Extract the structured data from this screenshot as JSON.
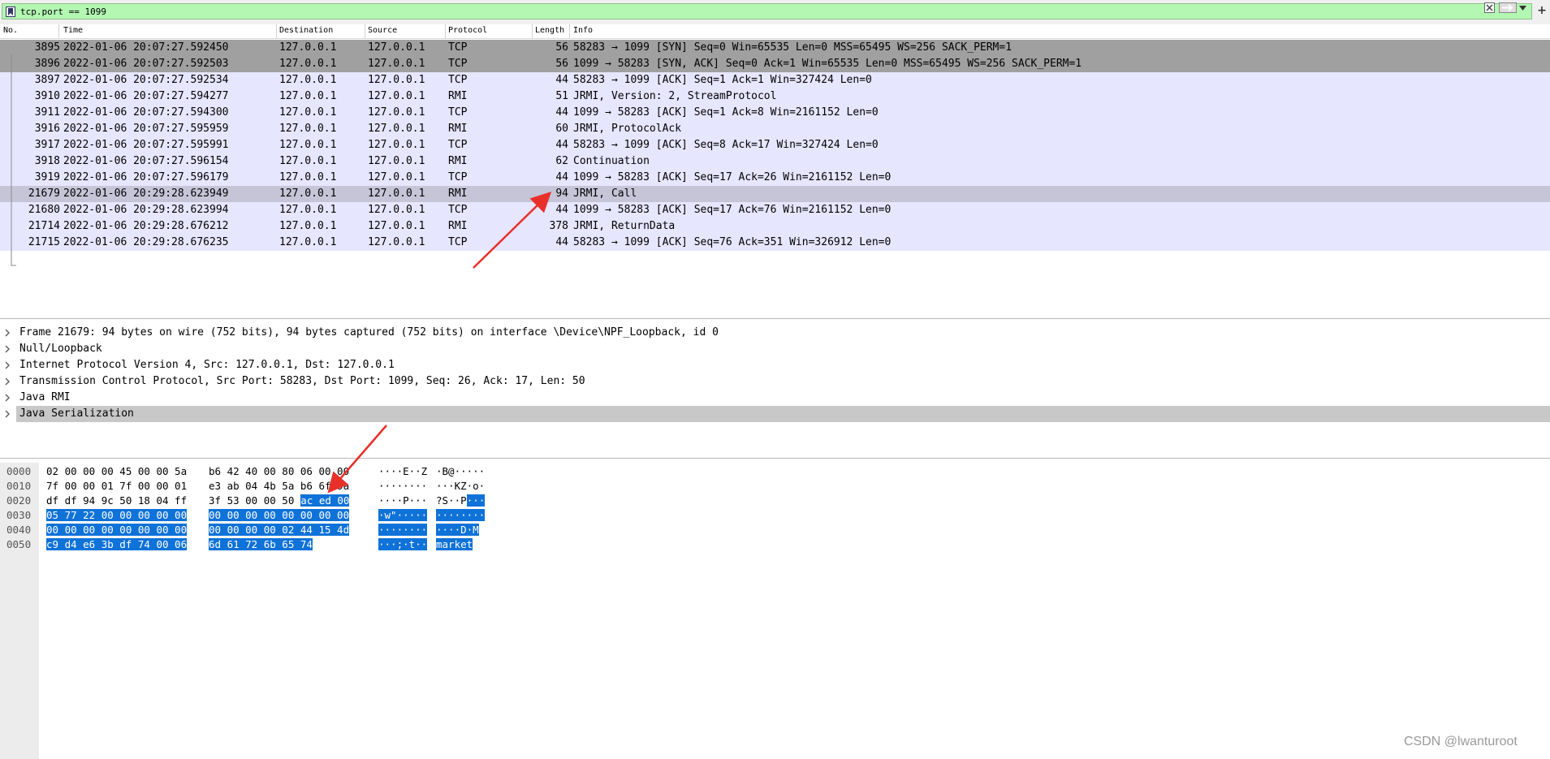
{
  "filter": {
    "value": "tcp.port == 1099",
    "placeholder": "",
    "color": "#b3f7b3"
  },
  "packet_list": {
    "columns": [
      "No.",
      "Time",
      "Destination",
      "Source",
      "Protocol",
      "Length",
      "Info"
    ],
    "rows": [
      {
        "no": "3895",
        "time": "2022-01-06 20:07:27.592450",
        "dst": "127.0.0.1",
        "src": "127.0.0.1",
        "proto": "TCP",
        "len": "56",
        "info": "58283 → 1099 [SYN] Seq=0 Win=65535 Len=0 MSS=65495 WS=256 SACK_PERM=1",
        "bg": "#a0a0a0"
      },
      {
        "no": "3896",
        "time": "2022-01-06 20:07:27.592503",
        "dst": "127.0.0.1",
        "src": "127.0.0.1",
        "proto": "TCP",
        "len": "56",
        "info": "1099 → 58283 [SYN, ACK] Seq=0 Ack=1 Win=65535 Len=0 MSS=65495 WS=256 SACK_PERM=1",
        "bg": "#a0a0a0"
      },
      {
        "no": "3897",
        "time": "2022-01-06 20:07:27.592534",
        "dst": "127.0.0.1",
        "src": "127.0.0.1",
        "proto": "TCP",
        "len": "44",
        "info": "58283 → 1099 [ACK] Seq=1 Ack=1 Win=327424 Len=0",
        "bg": "#e7e6ff"
      },
      {
        "no": "3910",
        "time": "2022-01-06 20:07:27.594277",
        "dst": "127.0.0.1",
        "src": "127.0.0.1",
        "proto": "RMI",
        "len": "51",
        "info": "JRMI, Version: 2, StreamProtocol",
        "bg": "#e7e6ff"
      },
      {
        "no": "3911",
        "time": "2022-01-06 20:07:27.594300",
        "dst": "127.0.0.1",
        "src": "127.0.0.1",
        "proto": "TCP",
        "len": "44",
        "info": "1099 → 58283 [ACK] Seq=1 Ack=8 Win=2161152 Len=0",
        "bg": "#e7e6ff"
      },
      {
        "no": "3916",
        "time": "2022-01-06 20:07:27.595959",
        "dst": "127.0.0.1",
        "src": "127.0.0.1",
        "proto": "RMI",
        "len": "60",
        "info": "JRMI, ProtocolAck",
        "bg": "#e7e6ff"
      },
      {
        "no": "3917",
        "time": "2022-01-06 20:07:27.595991",
        "dst": "127.0.0.1",
        "src": "127.0.0.1",
        "proto": "TCP",
        "len": "44",
        "info": "58283 → 1099 [ACK] Seq=8 Ack=17 Win=327424 Len=0",
        "bg": "#e7e6ff"
      },
      {
        "no": "3918",
        "time": "2022-01-06 20:07:27.596154",
        "dst": "127.0.0.1",
        "src": "127.0.0.1",
        "proto": "RMI",
        "len": "62",
        "info": "Continuation",
        "bg": "#e7e6ff"
      },
      {
        "no": "3919",
        "time": "2022-01-06 20:07:27.596179",
        "dst": "127.0.0.1",
        "src": "127.0.0.1",
        "proto": "TCP",
        "len": "44",
        "info": "1099 → 58283 [ACK] Seq=17 Ack=26 Win=2161152 Len=0",
        "bg": "#e7e6ff"
      },
      {
        "no": "21679",
        "time": "2022-01-06 20:29:28.623949",
        "dst": "127.0.0.1",
        "src": "127.0.0.1",
        "proto": "RMI",
        "len": "94",
        "info": "JRMI, Call",
        "bg": "#c6c5d8"
      },
      {
        "no": "21680",
        "time": "2022-01-06 20:29:28.623994",
        "dst": "127.0.0.1",
        "src": "127.0.0.1",
        "proto": "TCP",
        "len": "44",
        "info": "1099 → 58283 [ACK] Seq=17 Ack=76 Win=2161152 Len=0",
        "bg": "#e7e6ff"
      },
      {
        "no": "21714",
        "time": "2022-01-06 20:29:28.676212",
        "dst": "127.0.0.1",
        "src": "127.0.0.1",
        "proto": "RMI",
        "len": "378",
        "info": "JRMI, ReturnData",
        "bg": "#e7e6ff"
      },
      {
        "no": "21715",
        "time": "2022-01-06 20:29:28.676235",
        "dst": "127.0.0.1",
        "src": "127.0.0.1",
        "proto": "TCP",
        "len": "44",
        "info": "58283 → 1099 [ACK] Seq=76 Ack=351 Win=326912 Len=0",
        "bg": "#e7e6ff"
      }
    ]
  },
  "details": {
    "rows": [
      {
        "text": "Frame 21679: 94 bytes on wire (752 bits), 94 bytes captured (752 bits) on interface \\Device\\NPF_Loopback, id 0",
        "selected": false
      },
      {
        "text": "Null/Loopback",
        "selected": false
      },
      {
        "text": "Internet Protocol Version 4, Src: 127.0.0.1, Dst: 127.0.0.1",
        "selected": false
      },
      {
        "text": "Transmission Control Protocol, Src Port: 58283, Dst Port: 1099, Seq: 26, Ack: 17, Len: 50",
        "selected": false
      },
      {
        "text": "Java RMI",
        "selected": false
      },
      {
        "text": "Java Serialization",
        "selected": true
      }
    ]
  },
  "hex": {
    "rows": [
      {
        "offset": "0000",
        "hex1": "02 00 00 00 45 00 00 5a",
        "hex2": "b6 42 40 00 80 06 00 00",
        "ascii1": "····E··Z",
        "ascii2": "·B@·····",
        "sel_hex1": "",
        "sel_hex2": "",
        "sel_ascii1": "",
        "sel_ascii2": ""
      },
      {
        "offset": "0010",
        "hex1": "7f 00 00 01 7f 00 00 01",
        "hex2": "e3 ab 04 4b 5a b6 6f 9a",
        "ascii1": "········",
        "ascii2": "···KZ·o·",
        "sel_hex1": "",
        "sel_hex2": "",
        "sel_ascii1": "",
        "sel_ascii2": ""
      },
      {
        "offset": "0020",
        "hex1": "df df 94 9c 50 18 04 ff",
        "hex2": "3f 53 00 00 50",
        "sel_hex2": "ac ed 00",
        "ascii1": "····P···",
        "ascii2": "?S··P",
        "sel_ascii2": "···",
        "sel_hex1": "",
        "sel_ascii1": ""
      },
      {
        "offset": "0030",
        "hex1": "",
        "sel_hex1": "05 77 22 00 00 00 00 00",
        "hex2": "",
        "sel_hex2": "00 00 00 00 00 00 00 00",
        "ascii1": "",
        "sel_ascii1": "·w\"·····",
        "ascii2": "",
        "sel_ascii2": "········"
      },
      {
        "offset": "0040",
        "hex1": "",
        "sel_hex1": "00 00 00 00 00 00 00 00",
        "hex2": "",
        "sel_hex2": "00 00 00 00 02 44 15 4d",
        "ascii1": "",
        "sel_ascii1": "········",
        "ascii2": "",
        "sel_ascii2": "····D·M"
      },
      {
        "offset": "0050",
        "hex1": "",
        "sel_hex1": "c9 d4 e6 3b df 74 00 06",
        "hex2": "",
        "sel_hex2": "6d 61 72 6b 65 74",
        "ascii1": "",
        "sel_ascii1": "···;·t··",
        "ascii2": "",
        "sel_ascii2": "market"
      }
    ]
  },
  "watermark": "CSDN @lwanturoot",
  "colors": {
    "selection": "#0f72d8",
    "annotation_arrow": "#e8302a"
  }
}
